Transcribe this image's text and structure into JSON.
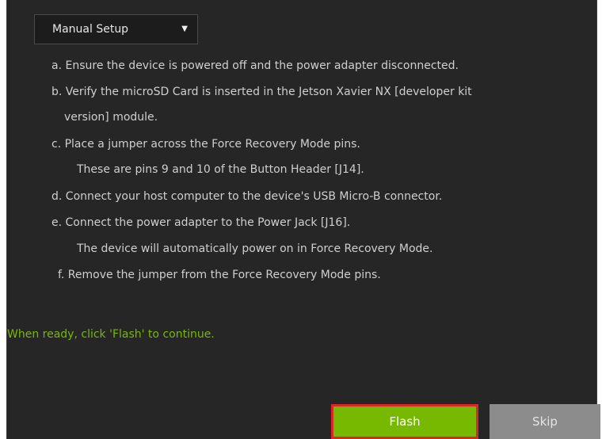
{
  "setup": {
    "mode_selected": "Manual Setup",
    "caret_icon": "caret-down-icon"
  },
  "steps": [
    "a. Ensure the device is powered off and the power adapter disconnected.",
    "b. Verify the microSD Card is inserted in the Jetson Xavier NX [developer kit",
    "version] module.",
    "c. Place a jumper across the Force Recovery Mode pins.",
    "These are pins 9 and 10 of the Button Header [J14].",
    "d. Connect your host computer to the device's USB Micro-B connector.",
    "e. Connect the power adapter to the Power Jack [J16].",
    "The device will automatically power on in Force Recovery Mode.",
    "f. Remove the jumper from the Force Recovery Mode pins."
  ],
  "prompt": "When ready, click 'Flash' to continue.",
  "buttons": {
    "flash": "Flash",
    "skip": "Skip"
  },
  "colors": {
    "background": "#262626",
    "accent_green": "#76b900",
    "highlight_red": "#d8262b",
    "skip_gray": "#8c8c8c"
  }
}
